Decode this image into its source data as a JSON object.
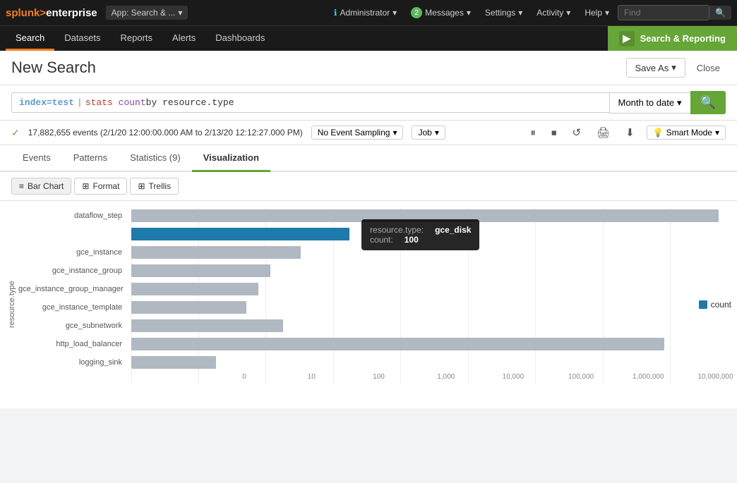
{
  "brand": {
    "splunk": "splunk",
    "gt": ">",
    "enterprise": "enterprise"
  },
  "topnav": {
    "app_label": "App: Search & ...",
    "info_icon": "ℹ",
    "admin_label": "Administrator",
    "messages_count": "2",
    "messages_label": "Messages",
    "settings_label": "Settings",
    "activity_label": "Activity",
    "help_label": "Help",
    "find_placeholder": "Find"
  },
  "secondnav": {
    "tabs": [
      {
        "label": "Search",
        "active": true
      },
      {
        "label": "Datasets",
        "active": false
      },
      {
        "label": "Reports",
        "active": false
      },
      {
        "label": "Alerts",
        "active": false
      },
      {
        "label": "Dashboards",
        "active": false
      }
    ],
    "search_reporting": "Search & Reporting",
    "sr_icon": "▶"
  },
  "page": {
    "title": "New Search",
    "save_as": "Save As",
    "close": "Close"
  },
  "search": {
    "query": "index=test | stats count by resource.type",
    "query_parts": {
      "keyword": "index=test",
      "pipe": "|",
      "cmd": "stats",
      "fn": "count",
      "rest": "by resource.type"
    },
    "time_range": "Month to date",
    "go_icon": "🔍"
  },
  "status": {
    "check": "✓",
    "events_text": "17,882,655 events (2/1/20 12:00:00.000 AM to 2/13/20 12:12:27.000 PM)",
    "sampling": "No Event Sampling",
    "job": "Job",
    "smart_mode": "Smart Mode",
    "icons": [
      "⏸",
      "⏹",
      "↺",
      "🖨",
      "⬇"
    ]
  },
  "tabs": {
    "items": [
      {
        "label": "Events",
        "active": false
      },
      {
        "label": "Patterns",
        "active": false
      },
      {
        "label": "Statistics (9)",
        "active": false
      },
      {
        "label": "Visualization",
        "active": true
      }
    ]
  },
  "toolbar": {
    "bar_chart": "Bar Chart",
    "format": "Format",
    "trellis": "Trellis"
  },
  "chart": {
    "y_axis_label": "resource.type",
    "x_axis_labels": [
      "0",
      "10",
      "100",
      "1,000",
      "10,000",
      "100,000",
      "1,000,000",
      "10,000,000"
    ],
    "x_positions": [
      0,
      8.33,
      16.67,
      25,
      33.33,
      41.67,
      50,
      58.33,
      66.67,
      75,
      83.33,
      91.67,
      100
    ],
    "bars": [
      {
        "label": "dataflow_step",
        "value": 9700000,
        "pct": 97,
        "highlighted": false
      },
      {
        "label": "gce_disk",
        "value": 100,
        "pct": 36,
        "highlighted": true
      },
      {
        "label": "gce_instance",
        "value": 38,
        "pct": 28,
        "highlighted": false
      },
      {
        "label": "gce_instance_group",
        "value": 29,
        "pct": 23,
        "highlighted": false
      },
      {
        "label": "gce_instance_group_manager",
        "value": 26,
        "pct": 21,
        "highlighted": false
      },
      {
        "label": "gce_instance_template",
        "value": 23,
        "pct": 19,
        "highlighted": false
      },
      {
        "label": "gce_subnetwork",
        "value": 55,
        "pct": 25,
        "highlighted": false
      },
      {
        "label": "http_load_balancer",
        "value": 8500000,
        "pct": 88,
        "highlighted": false
      },
      {
        "label": "logging_sink",
        "value": 18,
        "pct": 14,
        "highlighted": false
      }
    ],
    "legend": {
      "color": "#1d7aaa",
      "label": "count"
    },
    "tooltip": {
      "key1": "resource.type:",
      "val1": "gce_disk",
      "key2": "count:",
      "val2": "100"
    }
  }
}
